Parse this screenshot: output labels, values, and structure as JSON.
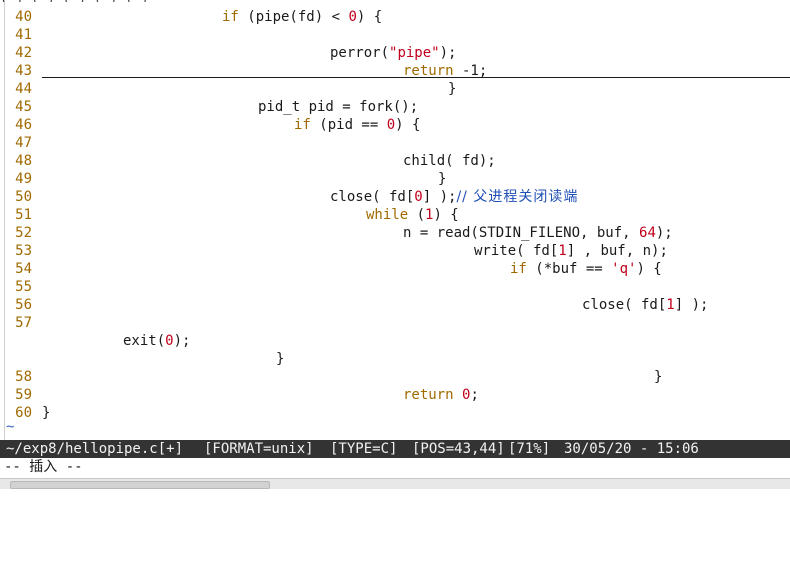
{
  "editor": {
    "lines": [
      {
        "num": "40",
        "parts": [
          [
            "kw",
            "if"
          ],
          [
            "t",
            " (pipe(fd) "
          ],
          [
            "t",
            "< "
          ],
          [
            "num",
            "0"
          ],
          [
            "t",
            ") {"
          ]
        ]
      },
      {
        "num": "41",
        "parts": []
      },
      {
        "num": "42",
        "parts": [
          [
            "t",
            "perror("
          ],
          [
            "str",
            "\"pipe\""
          ],
          [
            "t",
            ");"
          ]
        ]
      },
      {
        "num": "43",
        "parts": [
          [
            "kw",
            "return"
          ],
          [
            "t",
            " -1;"
          ]
        ]
      },
      {
        "num": "44",
        "parts": [
          [
            "t",
            "}"
          ]
        ]
      },
      {
        "num": "45",
        "parts": [
          [
            "t",
            "pid_t pid = fork();"
          ]
        ]
      },
      {
        "num": "46",
        "parts": [
          [
            "kw",
            "if"
          ],
          [
            "t",
            " (pid == "
          ],
          [
            "num",
            "0"
          ],
          [
            "t",
            ") {"
          ]
        ]
      },
      {
        "num": "47",
        "parts": []
      },
      {
        "num": "48",
        "parts": [
          [
            "t",
            "child( fd);"
          ]
        ]
      },
      {
        "num": "49",
        "parts": [
          [
            "t",
            "}"
          ]
        ]
      },
      {
        "num": "50",
        "parts": [
          [
            "t",
            "close( fd["
          ],
          [
            "num",
            "0"
          ],
          [
            "t",
            "] );"
          ],
          [
            "cmt",
            "// 父进程关闭读端"
          ]
        ]
      },
      {
        "num": "51",
        "parts": [
          [
            "kw",
            "while"
          ],
          [
            "t",
            " ("
          ],
          [
            "num",
            "1"
          ],
          [
            "t",
            ") {"
          ]
        ]
      },
      {
        "num": "52",
        "parts": [
          [
            "t",
            "n = read(STDIN_FILENO, buf, "
          ],
          [
            "num",
            "64"
          ],
          [
            "t",
            ");"
          ]
        ]
      },
      {
        "num": "53",
        "parts": [
          [
            "t",
            "write( fd["
          ],
          [
            "num",
            "1"
          ],
          [
            "t",
            "] , buf, n);"
          ]
        ]
      },
      {
        "num": "54",
        "parts": [
          [
            "kw",
            "if"
          ],
          [
            "t",
            " (*buf == "
          ],
          [
            "str",
            "'q'"
          ],
          [
            "t",
            ") {"
          ]
        ]
      },
      {
        "num": "55",
        "parts": []
      },
      {
        "num": "56",
        "parts": [
          [
            "t",
            "close( fd["
          ],
          [
            "num",
            "1"
          ],
          [
            "t",
            "] );"
          ]
        ]
      },
      {
        "num": "57",
        "parts": []
      },
      {
        "num": "",
        "parts": [
          [
            "t",
            "exit("
          ],
          [
            "num",
            "0"
          ],
          [
            "t",
            ");"
          ]
        ]
      },
      {
        "num": "",
        "parts": [
          [
            "t",
            "}"
          ]
        ]
      },
      {
        "num": "58",
        "parts": [
          [
            "t",
            "}"
          ]
        ]
      },
      {
        "num": "59",
        "parts": [
          [
            "kw",
            "return"
          ],
          [
            "t",
            " "
          ],
          [
            "num",
            "0"
          ],
          [
            "t",
            ";"
          ]
        ]
      },
      {
        "num": "60",
        "parts": [
          [
            "t",
            "}"
          ]
        ]
      }
    ],
    "tilde": "~"
  },
  "statusbar": {
    "file": "~/exp8/hellopipe.c[+]",
    "format": "[FORMAT=unix]",
    "type": "[TYPE=C]",
    "pos": "[POS=43,44]",
    "percent": "[71%]",
    "datetime": "30/05/20 - 15:06"
  },
  "cmdline": {
    "mode": "-- 插入 --"
  },
  "colors": {
    "keyword": "#a06a00",
    "number": "#c0001b",
    "comment": "#1f4fb5",
    "statusbar_bg": "#333333"
  }
}
